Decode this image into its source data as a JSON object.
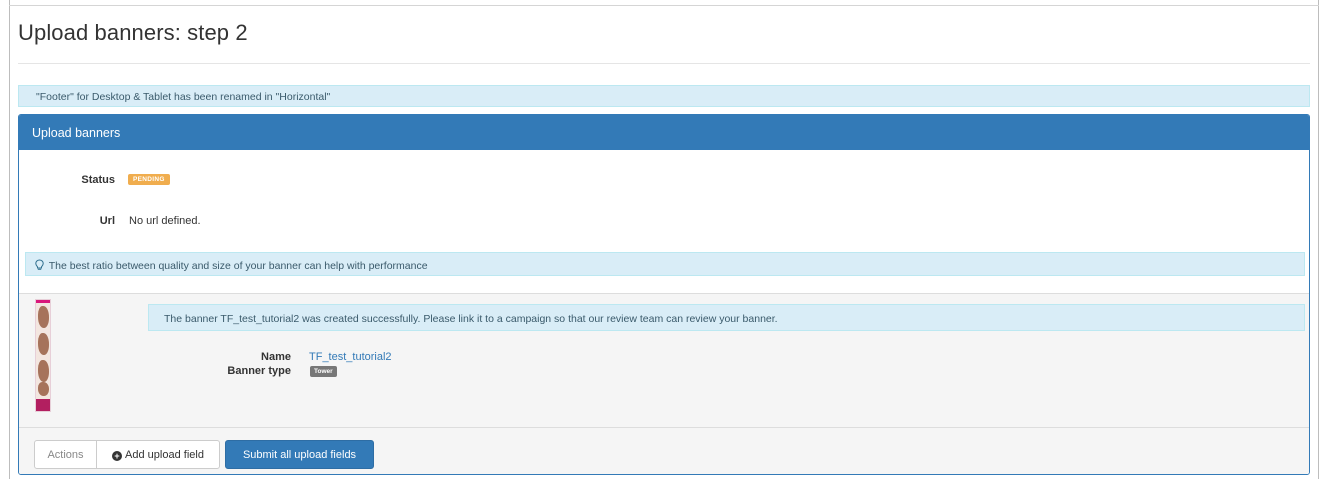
{
  "page": {
    "title": "Upload banners: step 2"
  },
  "rename_alert": {
    "text": "\"Footer\" for Desktop & Tablet has been renamed in \"Horizontal\""
  },
  "panel": {
    "heading": "Upload banners",
    "status_label": "Status",
    "status_value": "PENDING",
    "url_label": "Url",
    "url_value": "No url defined.",
    "tip_text": "The best ratio between quality and size of your banner can help with performance",
    "tip_icon": "lightbulb-icon"
  },
  "banner": {
    "success_message": "The banner TF_test_tutorial2 was created successfully. Please link it to a campaign so that our review team can review your banner.",
    "name_label": "Name",
    "name_value": "TF_test_tutorial2",
    "type_label": "Banner type",
    "type_value": "Tower"
  },
  "footer": {
    "actions_label": "Actions",
    "add_label": "Add upload field",
    "add_icon": "plus-circle-icon",
    "submit_label": "Submit all upload fields"
  },
  "colors": {
    "primary": "#337ab7",
    "info_bg": "#d9edf7",
    "warning": "#f0ad4e",
    "default_label": "#777777"
  }
}
